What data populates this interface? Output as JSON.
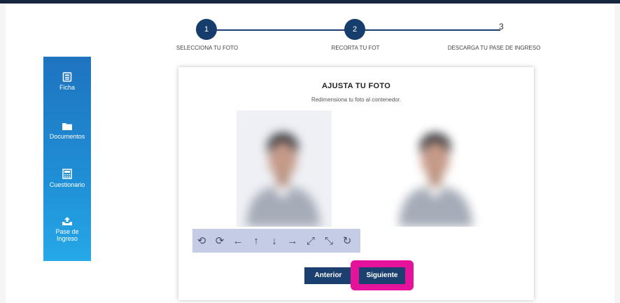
{
  "stepper": {
    "step1_number": "1",
    "step2_number": "2",
    "step3_number": "3",
    "step1_label": "SELECCIONA TU FOTO",
    "step2_label": "RECORTA TU FOT",
    "step3_label": "DESCARGA TU PASE DE INGRESO"
  },
  "sidebar": {
    "items": [
      {
        "label": "Ficha",
        "icon": "id-card-icon"
      },
      {
        "label": "Documentos",
        "icon": "folder-icon"
      },
      {
        "label": "Cuestionario",
        "icon": "calculator-icon"
      },
      {
        "label": "Pase de Ingreso",
        "icon": "upload-tray-icon"
      }
    ]
  },
  "card": {
    "title": "AJUSTA TU FOTO",
    "subtitle": "Redimensiona tu foto al contenedor."
  },
  "toolbar": {
    "buttons": [
      {
        "glyph": "⟲",
        "icon": "rotate-left-icon"
      },
      {
        "glyph": "⟳",
        "icon": "rotate-right-icon"
      },
      {
        "glyph": "←",
        "icon": "arrow-left-icon"
      },
      {
        "glyph": "↑",
        "icon": "arrow-up-icon"
      },
      {
        "glyph": "↓",
        "icon": "arrow-down-icon"
      },
      {
        "glyph": "→",
        "icon": "arrow-right-icon"
      },
      {
        "glyph": "⤢",
        "icon": "zoom-in-icon"
      },
      {
        "glyph": "⤡",
        "icon": "zoom-out-icon"
      },
      {
        "glyph": "↻",
        "icon": "reset-icon"
      }
    ]
  },
  "buttons": {
    "prev_label": "Anterior",
    "next_label": "Siguiente"
  },
  "colors": {
    "primary": "#173d6d",
    "sidebar_top": "#1f73bf",
    "sidebar_bottom": "#26a8e8",
    "highlight": "#e5139b",
    "toolbar_bg": "#c5cde6"
  }
}
